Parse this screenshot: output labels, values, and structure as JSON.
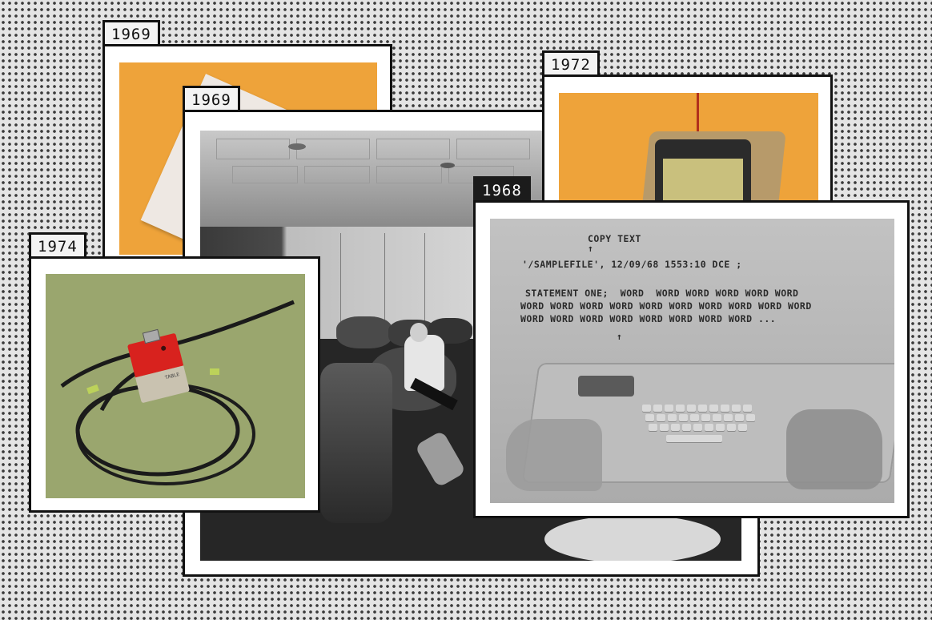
{
  "collage": {
    "cards": [
      {
        "id": "tablet",
        "year": "1969"
      },
      {
        "id": "room",
        "year": "1969"
      },
      {
        "id": "alto",
        "year": "1972"
      },
      {
        "id": "mouse",
        "year": "1974"
      },
      {
        "id": "nls",
        "year": "1968"
      }
    ],
    "screen_text": {
      "title": "COPY TEXT",
      "caret": "↑",
      "file_line": "'/SAMPLEFILE', 12/09/68 1553:10 DCE ;",
      "statement_line": "STATEMENT ONE;  WORD  WORD WORD WORD WORD WORD",
      "word_line_1": "WORD WORD WORD WORD WORD WORD WORD WORD WORD WORD",
      "word_line_2": "WORD WORD WORD WORD WORD WORD WORD WORD ...",
      "pointer": "↑"
    },
    "device_label": "TABLE"
  },
  "colors": {
    "background": "#e4e4e4",
    "dots": "#3a3a3a",
    "orange": "#eea33a",
    "olive": "#9aa66e",
    "mouse_red": "#d8221e"
  }
}
